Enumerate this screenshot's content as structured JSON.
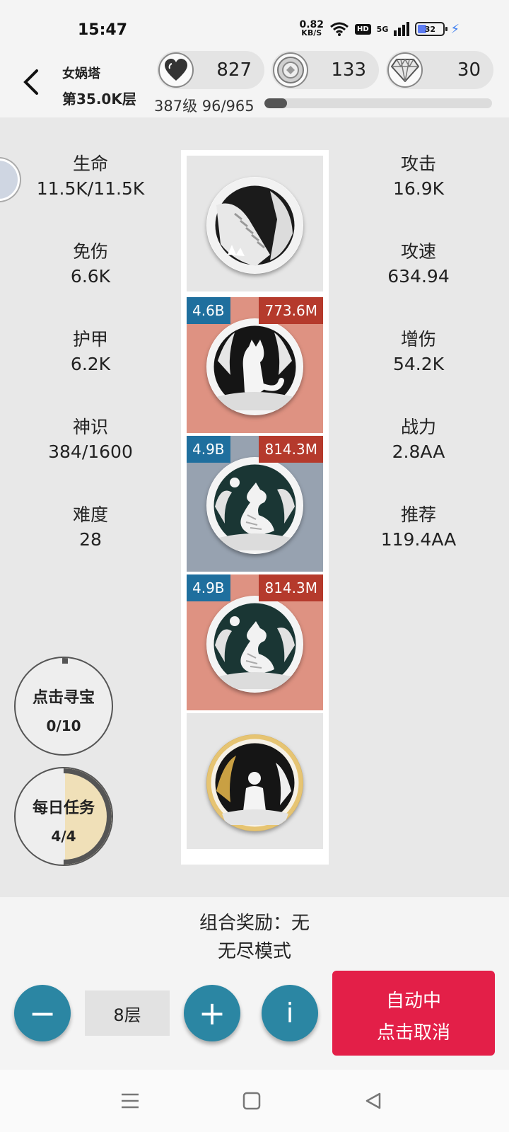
{
  "status_bar": {
    "time": "15:47",
    "net_speed_value": "0.82",
    "net_speed_unit": "KB/S",
    "hd_label": "HD",
    "signal_label": "5G",
    "battery_level": "32",
    "icons": [
      "wifi-icon",
      "signal-icon",
      "battery-icon",
      "charging-bolt-icon"
    ]
  },
  "header": {
    "tower_name": "女娲塔",
    "floor": "第35.0K层",
    "resources": [
      {
        "icon": "heart-icon",
        "value": "827"
      },
      {
        "icon": "coin-icon",
        "value": "133"
      },
      {
        "icon": "diamond-icon",
        "value": "30"
      }
    ],
    "level_text": "387级 96/965",
    "level_progress": 0.0995
  },
  "stats_left": [
    {
      "label": "生命",
      "value": "11.5K/11.5K"
    },
    {
      "label": "免伤",
      "value": "6.6K"
    },
    {
      "label": "护甲",
      "value": "6.2K"
    },
    {
      "label": "神识",
      "value": "384/1600"
    },
    {
      "label": "难度",
      "value": "28"
    }
  ],
  "stats_right": [
    {
      "label": "攻击",
      "value": "16.9K"
    },
    {
      "label": "攻速",
      "value": "634.94"
    },
    {
      "label": "增伤",
      "value": "54.2K"
    },
    {
      "label": "战力",
      "value": "2.8AA"
    },
    {
      "label": "推荐",
      "value": "119.4AA"
    }
  ],
  "cards": [
    {
      "name": "staircase-card",
      "bg": "#e6e6e6",
      "left_badge": "",
      "right_badge": ""
    },
    {
      "name": "fox-card",
      "bg": "#de9282",
      "left_badge": "4.6B",
      "right_badge": "773.6M"
    },
    {
      "name": "dragon-card-1",
      "bg": "#97a2b0",
      "left_badge": "4.9B",
      "right_badge": "814.3M"
    },
    {
      "name": "dragon-card-2",
      "bg": "#de9282",
      "left_badge": "4.9B",
      "right_badge": "814.3M"
    },
    {
      "name": "girl-card",
      "bg": "#e6e6e6",
      "left_badge": "",
      "right_badge": ""
    }
  ],
  "treasure": {
    "title": "点击寻宝",
    "value": "0/10"
  },
  "daily": {
    "title": "每日任务",
    "value": "4/4"
  },
  "bottom": {
    "combo_reward": "组合奖励：无",
    "mode": "无尽模式",
    "minus_label": "−",
    "floor_value": "8层",
    "plus_label": "+",
    "info_label": "i",
    "auto_line1": "自动中",
    "auto_line2": "点击取消"
  },
  "colors": {
    "accent_blue": "#2b86a3",
    "auto_red": "#e31f48",
    "badge_blue": "#1f6f9e",
    "badge_red": "#b53a2c"
  }
}
